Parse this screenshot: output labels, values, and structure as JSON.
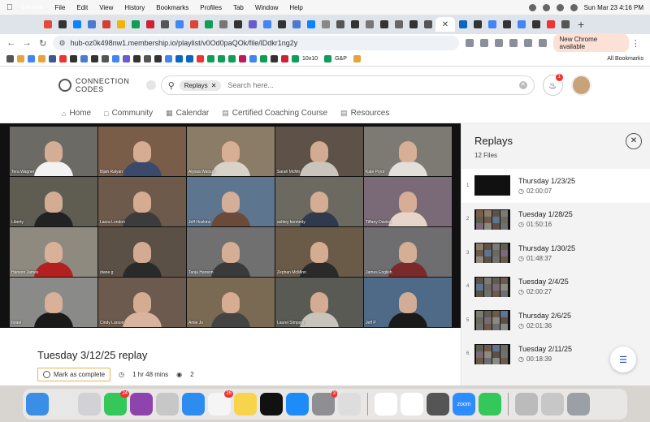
{
  "menubar": {
    "app": "Chrome",
    "items": [
      "File",
      "Edit",
      "View",
      "History",
      "Bookmarks",
      "Profiles",
      "Tab",
      "Window",
      "Help"
    ],
    "clock": "Sun Mar 23  4:16 PM"
  },
  "browser": {
    "url": "hub-oz0k498nw1.membership.io/playlist/v0Od0paQOk/file/lDdkr1ng2y",
    "update_label": "New Chrome available",
    "all_bookmarks": "All Bookmarks",
    "bookmark_labels": [
      "10x10",
      "G&P"
    ]
  },
  "site": {
    "logo_line1": "CONNECTION",
    "logo_line2": "CODES",
    "search_chip": "Replays",
    "search_placeholder": "Search here...",
    "notification_count": "1",
    "nav": [
      {
        "label": "Home",
        "icon": "home-icon"
      },
      {
        "label": "Community",
        "icon": "chat-icon"
      },
      {
        "label": "Calendar",
        "icon": "calendar-icon"
      },
      {
        "label": "Certified Coaching Course",
        "icon": "document-icon"
      },
      {
        "label": "Resources",
        "icon": "document-icon"
      }
    ]
  },
  "video": {
    "participants": [
      "Tera Wagner",
      "Bijah Ralyan",
      "Alyssa Watson",
      "Sarah McMn",
      "Kate Pryor",
      "Liberty",
      "Laura London",
      "Jeff Hoskins",
      "ashley kennedy",
      "Tiffany Davies",
      "Hanson James",
      "diane g",
      "Tanja Hanson",
      "Zephan McMinn",
      "James English",
      "Israel",
      "Cindy Larson",
      "Amie Jo",
      "Laurel Simpson",
      "Jeff P"
    ]
  },
  "replay": {
    "title": "Tuesday 3/12/25 replay",
    "complete_label": "Mark as complete",
    "duration": "1 hr 48 mins",
    "views": "2"
  },
  "panel": {
    "title": "Replays",
    "count": "12 Files",
    "items": [
      {
        "index": "1",
        "title": "Thursday 1/23/25",
        "duration": "02:00:07"
      },
      {
        "index": "2",
        "title": "Tuesday 1/28/25",
        "duration": "01:50:16"
      },
      {
        "index": "3",
        "title": "Thursday 1/30/25",
        "duration": "01:48:37"
      },
      {
        "index": "4",
        "title": "Tuesday 2/4/25",
        "duration": "02:00:27"
      },
      {
        "index": "5",
        "title": "Thursday 2/6/25",
        "duration": "02:01:36"
      },
      {
        "index": "6",
        "title": "Tuesday 2/11/25",
        "duration": "00:18:39"
      }
    ]
  },
  "dock": {
    "badges": {
      "messages": "24",
      "calendar": "26",
      "settings": "3"
    },
    "zoom_label": "zoom"
  }
}
